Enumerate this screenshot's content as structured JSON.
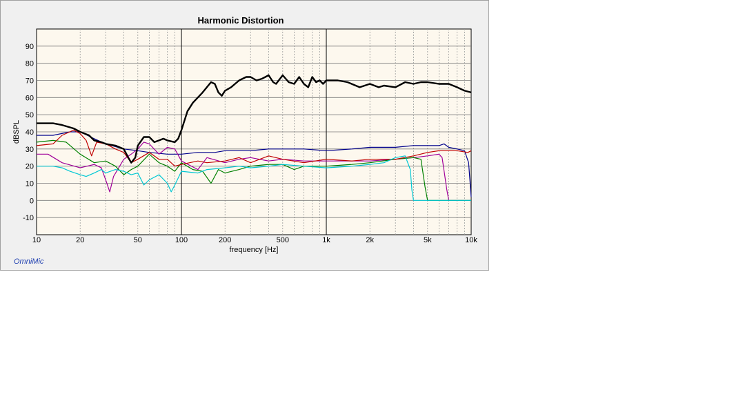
{
  "brand": "OmniMic",
  "chart_data": {
    "type": "line",
    "title": "Harmonic Distortion",
    "xlabel": "frequency [Hz]",
    "ylabel": "dBSPL",
    "xscale": "log",
    "xlim": [
      10,
      10000
    ],
    "ylim": [
      -20,
      100
    ],
    "grid": true,
    "xticks": [
      {
        "v": 10,
        "label": "10"
      },
      {
        "v": 20,
        "label": "20"
      },
      {
        "v": 50,
        "label": "50"
      },
      {
        "v": 100,
        "label": "100"
      },
      {
        "v": 200,
        "label": "200"
      },
      {
        "v": 500,
        "label": "500"
      },
      {
        "v": 1000,
        "label": "1k"
      },
      {
        "v": 2000,
        "label": "2k"
      },
      {
        "v": 5000,
        "label": "5k"
      },
      {
        "v": 10000,
        "label": "10k"
      }
    ],
    "yticks": [
      -10,
      0,
      10,
      20,
      30,
      40,
      50,
      60,
      70,
      80,
      90
    ],
    "series": [
      {
        "color": "#00008b",
        "width": 1.2,
        "points": [
          [
            10,
            38
          ],
          [
            13,
            38
          ],
          [
            17,
            40
          ],
          [
            20,
            40
          ],
          [
            25,
            36
          ],
          [
            30,
            33
          ],
          [
            40,
            30
          ],
          [
            50,
            29
          ],
          [
            60,
            28
          ],
          [
            80,
            27
          ],
          [
            100,
            27
          ],
          [
            130,
            28
          ],
          [
            170,
            28
          ],
          [
            200,
            29
          ],
          [
            250,
            29
          ],
          [
            300,
            29
          ],
          [
            400,
            30
          ],
          [
            500,
            30
          ],
          [
            700,
            30
          ],
          [
            1000,
            29
          ],
          [
            1500,
            30
          ],
          [
            2000,
            31
          ],
          [
            3000,
            31
          ],
          [
            4000,
            32
          ],
          [
            5000,
            32
          ],
          [
            6000,
            32
          ],
          [
            6500,
            33
          ],
          [
            7000,
            31
          ],
          [
            8000,
            30
          ],
          [
            9000,
            29
          ],
          [
            9600,
            22
          ],
          [
            10000,
            2
          ]
        ]
      },
      {
        "color": "#a0009a",
        "width": 1.2,
        "points": [
          [
            10,
            27
          ],
          [
            12,
            27
          ],
          [
            15,
            22
          ],
          [
            20,
            19
          ],
          [
            25,
            21
          ],
          [
            28,
            19
          ],
          [
            30,
            12
          ],
          [
            32,
            5
          ],
          [
            34,
            14
          ],
          [
            40,
            24
          ],
          [
            45,
            27
          ],
          [
            50,
            30
          ],
          [
            55,
            34
          ],
          [
            60,
            33
          ],
          [
            70,
            27
          ],
          [
            80,
            31
          ],
          [
            90,
            30
          ],
          [
            100,
            23
          ],
          [
            130,
            18
          ],
          [
            150,
            25
          ],
          [
            200,
            22
          ],
          [
            250,
            24
          ],
          [
            300,
            25
          ],
          [
            400,
            23
          ],
          [
            500,
            24
          ],
          [
            700,
            23
          ],
          [
            1000,
            23
          ],
          [
            1500,
            23
          ],
          [
            2000,
            23
          ],
          [
            3000,
            24
          ],
          [
            4000,
            25
          ],
          [
            5000,
            26
          ],
          [
            6000,
            27
          ],
          [
            6300,
            25
          ],
          [
            6800,
            6
          ],
          [
            7000,
            0
          ],
          [
            10000,
            0
          ]
        ]
      },
      {
        "color": "#008000",
        "width": 1.2,
        "points": [
          [
            10,
            34
          ],
          [
            13,
            35
          ],
          [
            16,
            34
          ],
          [
            20,
            27
          ],
          [
            25,
            22
          ],
          [
            30,
            23
          ],
          [
            35,
            20
          ],
          [
            40,
            15
          ],
          [
            45,
            18
          ],
          [
            50,
            20
          ],
          [
            60,
            27
          ],
          [
            70,
            22
          ],
          [
            80,
            20
          ],
          [
            90,
            17
          ],
          [
            100,
            22
          ],
          [
            120,
            18
          ],
          [
            140,
            17
          ],
          [
            160,
            10
          ],
          [
            180,
            18
          ],
          [
            200,
            16
          ],
          [
            250,
            18
          ],
          [
            300,
            20
          ],
          [
            400,
            21
          ],
          [
            500,
            21
          ],
          [
            600,
            18
          ],
          [
            700,
            20
          ],
          [
            1000,
            20
          ],
          [
            1500,
            21
          ],
          [
            2000,
            22
          ],
          [
            3000,
            24
          ],
          [
            4000,
            25
          ],
          [
            4500,
            24
          ],
          [
            4800,
            8
          ],
          [
            5000,
            0
          ],
          [
            10000,
            0
          ]
        ]
      },
      {
        "color": "#c00000",
        "width": 1.2,
        "points": [
          [
            10,
            32
          ],
          [
            13,
            33
          ],
          [
            15,
            38
          ],
          [
            18,
            41
          ],
          [
            20,
            39
          ],
          [
            22,
            35
          ],
          [
            24,
            26
          ],
          [
            26,
            34
          ],
          [
            30,
            33
          ],
          [
            35,
            30
          ],
          [
            40,
            28
          ],
          [
            45,
            22
          ],
          [
            50,
            24
          ],
          [
            60,
            28
          ],
          [
            70,
            24
          ],
          [
            80,
            24
          ],
          [
            90,
            20
          ],
          [
            100,
            21
          ],
          [
            130,
            23
          ],
          [
            150,
            22
          ],
          [
            200,
            23
          ],
          [
            250,
            25
          ],
          [
            300,
            22
          ],
          [
            400,
            26
          ],
          [
            500,
            24
          ],
          [
            700,
            22
          ],
          [
            1000,
            24
          ],
          [
            1500,
            23
          ],
          [
            2000,
            24
          ],
          [
            3000,
            24
          ],
          [
            4000,
            26
          ],
          [
            5000,
            28
          ],
          [
            6000,
            29
          ],
          [
            8000,
            29
          ],
          [
            9500,
            28
          ],
          [
            10000,
            29
          ]
        ]
      },
      {
        "color": "#00c8d4",
        "width": 1.2,
        "points": [
          [
            10,
            20
          ],
          [
            13,
            20
          ],
          [
            15,
            19
          ],
          [
            17,
            17
          ],
          [
            20,
            15
          ],
          [
            22,
            14
          ],
          [
            25,
            16
          ],
          [
            28,
            18
          ],
          [
            30,
            16
          ],
          [
            35,
            18
          ],
          [
            40,
            17
          ],
          [
            45,
            15
          ],
          [
            50,
            16
          ],
          [
            55,
            9
          ],
          [
            60,
            12
          ],
          [
            70,
            15
          ],
          [
            80,
            10
          ],
          [
            85,
            5
          ],
          [
            90,
            9
          ],
          [
            100,
            17
          ],
          [
            130,
            16
          ],
          [
            150,
            18
          ],
          [
            200,
            19
          ],
          [
            250,
            20
          ],
          [
            300,
            19
          ],
          [
            400,
            20
          ],
          [
            500,
            21
          ],
          [
            700,
            20
          ],
          [
            1000,
            19
          ],
          [
            1500,
            20
          ],
          [
            2000,
            21
          ],
          [
            2500,
            22
          ],
          [
            3000,
            25
          ],
          [
            3500,
            26
          ],
          [
            3800,
            18
          ],
          [
            3900,
            6
          ],
          [
            4000,
            0
          ],
          [
            10000,
            0
          ]
        ]
      },
      {
        "color": "#000000",
        "width": 2.4,
        "points": [
          [
            10,
            45
          ],
          [
            13,
            45
          ],
          [
            15,
            44
          ],
          [
            18,
            42
          ],
          [
            20,
            40
          ],
          [
            23,
            38
          ],
          [
            25,
            35
          ],
          [
            28,
            34
          ],
          [
            30,
            33
          ],
          [
            35,
            32
          ],
          [
            40,
            30
          ],
          [
            43,
            25
          ],
          [
            45,
            22
          ],
          [
            48,
            25
          ],
          [
            50,
            32
          ],
          [
            55,
            37
          ],
          [
            60,
            37
          ],
          [
            65,
            34
          ],
          [
            70,
            35
          ],
          [
            75,
            36
          ],
          [
            80,
            35
          ],
          [
            90,
            34
          ],
          [
            95,
            36
          ],
          [
            100,
            41
          ],
          [
            110,
            52
          ],
          [
            120,
            57
          ],
          [
            140,
            63
          ],
          [
            160,
            69
          ],
          [
            170,
            68
          ],
          [
            180,
            63
          ],
          [
            190,
            61
          ],
          [
            200,
            64
          ],
          [
            220,
            66
          ],
          [
            250,
            70
          ],
          [
            280,
            72
          ],
          [
            300,
            72
          ],
          [
            330,
            70
          ],
          [
            360,
            71
          ],
          [
            400,
            73
          ],
          [
            430,
            69
          ],
          [
            450,
            68
          ],
          [
            500,
            73
          ],
          [
            550,
            69
          ],
          [
            600,
            68
          ],
          [
            650,
            72
          ],
          [
            700,
            68
          ],
          [
            750,
            66
          ],
          [
            800,
            72
          ],
          [
            850,
            69
          ],
          [
            900,
            70
          ],
          [
            950,
            68
          ],
          [
            1000,
            70
          ],
          [
            1200,
            70
          ],
          [
            1400,
            69
          ],
          [
            1700,
            66
          ],
          [
            2000,
            68
          ],
          [
            2300,
            66
          ],
          [
            2500,
            67
          ],
          [
            3000,
            66
          ],
          [
            3500,
            69
          ],
          [
            4000,
            68
          ],
          [
            4500,
            69
          ],
          [
            5000,
            69
          ],
          [
            6000,
            68
          ],
          [
            7000,
            68
          ],
          [
            8000,
            66
          ],
          [
            9000,
            64
          ],
          [
            10000,
            63
          ]
        ]
      }
    ]
  }
}
